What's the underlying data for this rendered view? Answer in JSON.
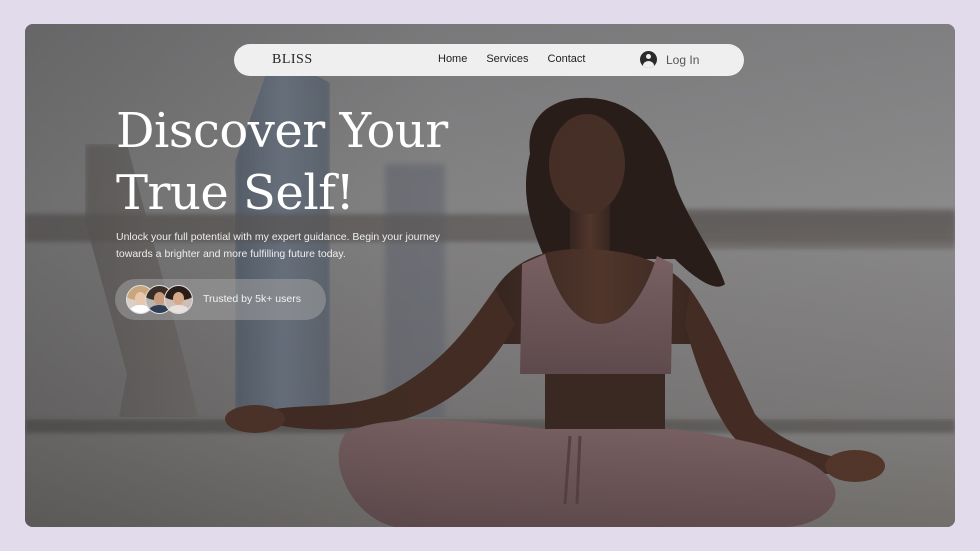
{
  "nav": {
    "brand": "BLISS",
    "links": [
      "Home",
      "Services",
      "Contact"
    ],
    "login_label": "Log In",
    "login_icon": "user-circle-icon"
  },
  "hero": {
    "title": "Discover Your True Self!",
    "subtitle": "Unlock your full potential with my expert guidance. Begin your journey towards a brighter and more fulfilling future today.",
    "trust_text": "Trusted by 5k+ users"
  },
  "colors": {
    "page_background": "#e2dbeb",
    "nav_background": "#f0eff0",
    "title_color": "#ffffff"
  }
}
